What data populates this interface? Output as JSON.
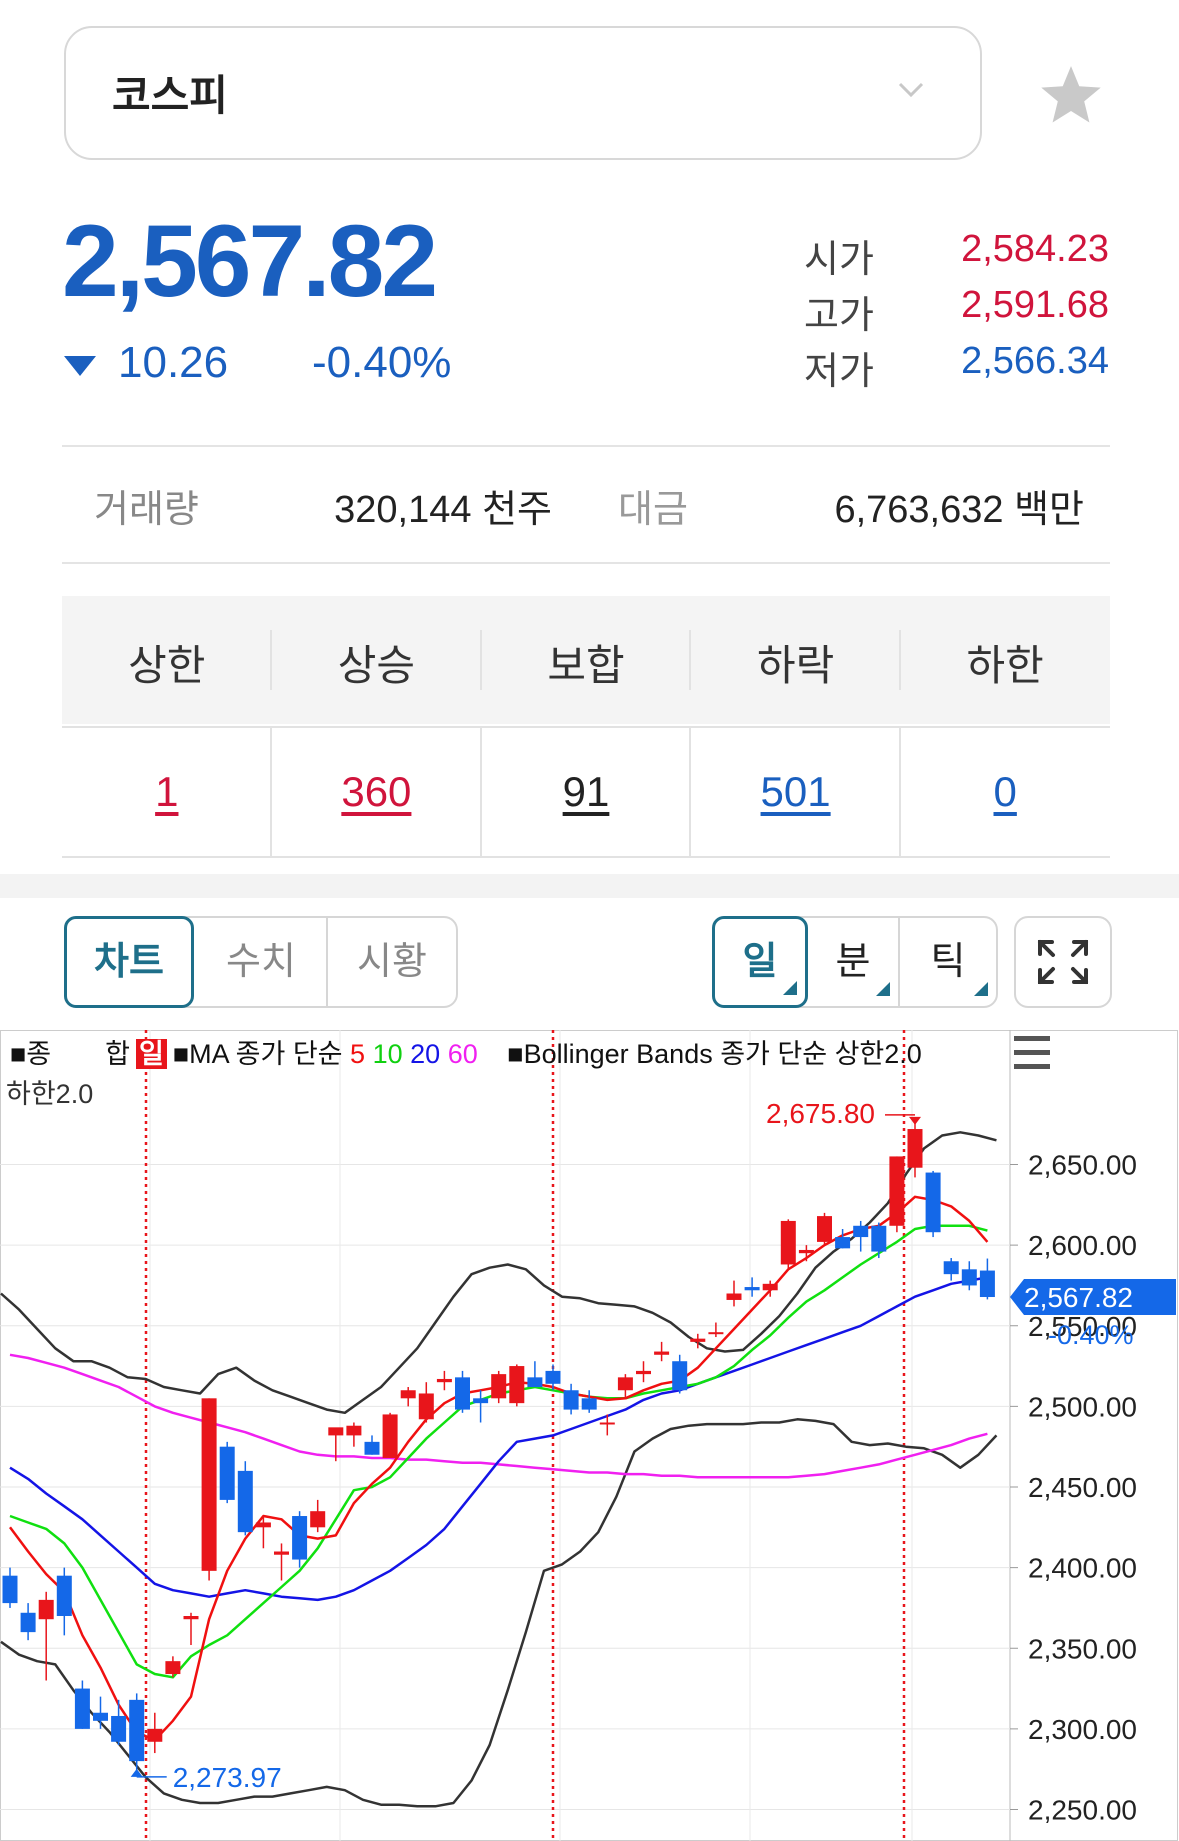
{
  "index_selector": {
    "label": "코스피"
  },
  "quote": {
    "price": "2,567.82",
    "change": "10.26",
    "change_pct": "-0.40%",
    "open_label": "시가",
    "open": "2,584.23",
    "high_label": "고가",
    "high": "2,591.68",
    "low_label": "저가",
    "low": "2,566.34"
  },
  "volume": {
    "label": "거래량",
    "value": "320,144 천주",
    "amount_label": "대금",
    "amount_value": "6,763,632 백만"
  },
  "breadth": {
    "headers": [
      "상한",
      "상승",
      "보합",
      "하락",
      "하한"
    ],
    "values": [
      "1",
      "360",
      "91",
      "501",
      "0"
    ]
  },
  "tabs": {
    "view": [
      "차트",
      "수치",
      "시황"
    ],
    "period": [
      "일",
      "분",
      "틱"
    ]
  },
  "legend": {
    "type_prefix": "■종　　합",
    "period_tag": "일",
    "ma_prefix": "■MA 종가 단순",
    "ma_periods": [
      "5",
      "10",
      "20",
      "60"
    ],
    "bb_label": "■Bollinger Bands 종가 단순 상한2.0",
    "bb_lower": "하한2.0"
  },
  "colors": {
    "up": "#e8151b",
    "down": "#1468e8",
    "ma5": "#f01010",
    "ma10": "#10e010",
    "ma20": "#1414e6",
    "ma60": "#f020f0",
    "bb": "#333333"
  },
  "chart_data": {
    "type": "candlestick",
    "y_ticks": [
      2250,
      2300,
      2350,
      2400,
      2450,
      2500,
      2550,
      2600,
      2650
    ],
    "y_tick_labels": [
      "2,250.00",
      "2,300.00",
      "2,350.00",
      "2,400.00",
      "2,450.00",
      "2,500.00",
      "2,550.00",
      "2,600.00",
      "2,650.00"
    ],
    "ylim": [
      2237,
      2738
    ],
    "current_price_label": "2,567.82",
    "current_price": 2567.82,
    "current_change_label": "-0.40%",
    "high_marker": {
      "label": "2,675.80",
      "value": 2675.8
    },
    "low_marker": {
      "label": "2,273.97",
      "value": 2273.97
    },
    "candles": [
      {
        "o": 2395,
        "h": 2400,
        "l": 2375,
        "c": 2378
      },
      {
        "o": 2372,
        "h": 2378,
        "l": 2355,
        "c": 2360
      },
      {
        "o": 2368,
        "h": 2385,
        "l": 2330,
        "c": 2380
      },
      {
        "o": 2395,
        "h": 2400,
        "l": 2358,
        "c": 2370
      },
      {
        "o": 2325,
        "h": 2330,
        "l": 2300,
        "c": 2300
      },
      {
        "o": 2310,
        "h": 2320,
        "l": 2300,
        "c": 2305
      },
      {
        "o": 2308,
        "h": 2318,
        "l": 2290,
        "c": 2292
      },
      {
        "o": 2318,
        "h": 2322,
        "l": 2273.97,
        "c": 2280
      },
      {
        "o": 2292,
        "h": 2310,
        "l": 2285,
        "c": 2300
      },
      {
        "o": 2334,
        "h": 2345,
        "l": 2332,
        "c": 2342
      },
      {
        "o": 2368,
        "h": 2372,
        "l": 2352,
        "c": 2370
      },
      {
        "o": 2398,
        "h": 2505,
        "l": 2392,
        "c": 2505
      },
      {
        "o": 2475,
        "h": 2478,
        "l": 2440,
        "c": 2442
      },
      {
        "o": 2460,
        "h": 2466,
        "l": 2420,
        "c": 2422
      },
      {
        "o": 2425,
        "h": 2432,
        "l": 2412,
        "c": 2428
      },
      {
        "o": 2408,
        "h": 2415,
        "l": 2392,
        "c": 2410
      },
      {
        "o": 2432,
        "h": 2435,
        "l": 2400,
        "c": 2405
      },
      {
        "o": 2425,
        "h": 2442,
        "l": 2422,
        "c": 2435
      },
      {
        "o": 2482,
        "h": 2486,
        "l": 2466,
        "c": 2487
      },
      {
        "o": 2482,
        "h": 2490,
        "l": 2475,
        "c": 2488
      },
      {
        "o": 2478,
        "h": 2482,
        "l": 2470,
        "c": 2470
      },
      {
        "o": 2468,
        "h": 2496,
        "l": 2468,
        "c": 2495
      },
      {
        "o": 2505,
        "h": 2512,
        "l": 2500,
        "c": 2510
      },
      {
        "o": 2492,
        "h": 2515,
        "l": 2490,
        "c": 2508
      },
      {
        "o": 2515,
        "h": 2522,
        "l": 2510,
        "c": 2517
      },
      {
        "o": 2518,
        "h": 2522,
        "l": 2496,
        "c": 2498
      },
      {
        "o": 2505,
        "h": 2510,
        "l": 2490,
        "c": 2502
      },
      {
        "o": 2505,
        "h": 2522,
        "l": 2502,
        "c": 2520
      },
      {
        "o": 2502,
        "h": 2526,
        "l": 2500,
        "c": 2525
      },
      {
        "o": 2518,
        "h": 2528,
        "l": 2512,
        "c": 2512
      },
      {
        "o": 2522,
        "h": 2526,
        "l": 2510,
        "c": 2514
      },
      {
        "o": 2510,
        "h": 2514,
        "l": 2495,
        "c": 2498
      },
      {
        "o": 2505,
        "h": 2510,
        "l": 2496,
        "c": 2498
      },
      {
        "o": 2490,
        "h": 2495,
        "l": 2482,
        "c": 2490
      },
      {
        "o": 2510,
        "h": 2520,
        "l": 2505,
        "c": 2518
      },
      {
        "o": 2520,
        "h": 2528,
        "l": 2515,
        "c": 2522
      },
      {
        "o": 2532,
        "h": 2540,
        "l": 2528,
        "c": 2534
      },
      {
        "o": 2528,
        "h": 2532,
        "l": 2508,
        "c": 2510
      },
      {
        "o": 2540,
        "h": 2545,
        "l": 2536,
        "c": 2542
      },
      {
        "o": 2545,
        "h": 2552,
        "l": 2543,
        "c": 2546
      },
      {
        "o": 2566,
        "h": 2578,
        "l": 2562,
        "c": 2570
      },
      {
        "o": 2574,
        "h": 2580,
        "l": 2568,
        "c": 2572
      },
      {
        "o": 2572,
        "h": 2578,
        "l": 2568,
        "c": 2576
      },
      {
        "o": 2588,
        "h": 2616,
        "l": 2585,
        "c": 2615
      },
      {
        "o": 2595,
        "h": 2600,
        "l": 2590,
        "c": 2597
      },
      {
        "o": 2602,
        "h": 2620,
        "l": 2600,
        "c": 2618
      },
      {
        "o": 2605,
        "h": 2610,
        "l": 2598,
        "c": 2598
      },
      {
        "o": 2612,
        "h": 2615,
        "l": 2596,
        "c": 2605
      },
      {
        "o": 2612,
        "h": 2614,
        "l": 2592,
        "c": 2596
      },
      {
        "o": 2612,
        "h": 2655,
        "l": 2608,
        "c": 2655
      },
      {
        "o": 2648,
        "h": 2675.8,
        "l": 2642,
        "c": 2672
      },
      {
        "o": 2645,
        "h": 2646,
        "l": 2605,
        "c": 2608
      },
      {
        "o": 2590,
        "h": 2592,
        "l": 2578,
        "c": 2582
      },
      {
        "o": 2585,
        "h": 2590,
        "l": 2572,
        "c": 2575
      },
      {
        "o": 2584.23,
        "h": 2591.68,
        "l": 2566.34,
        "c": 2567.82
      }
    ],
    "ma5": [
      2425,
      2410,
      2396,
      2385,
      2358,
      2338,
      2315,
      2298,
      2293,
      2305,
      2320,
      2368,
      2398,
      2418,
      2432,
      2430,
      2420,
      2418,
      2420,
      2440,
      2452,
      2462,
      2478,
      2492,
      2502,
      2508,
      2510,
      2512,
      2515,
      2514,
      2512,
      2508,
      2506,
      2504,
      2505,
      2510,
      2514,
      2516,
      2524,
      2536,
      2548,
      2560,
      2572,
      2585,
      2592,
      2600,
      2606,
      2610,
      2612,
      2620,
      2630,
      2628,
      2624,
      2615,
      2602
    ],
    "ma10": [
      2432,
      2428,
      2424,
      2415,
      2400,
      2380,
      2360,
      2340,
      2334,
      2332,
      2345,
      2352,
      2358,
      2368,
      2378,
      2388,
      2398,
      2412,
      2430,
      2448,
      2450,
      2456,
      2468,
      2480,
      2490,
      2500,
      2504,
      2508,
      2510,
      2512,
      2510,
      2508,
      2506,
      2505,
      2505,
      2508,
      2510,
      2512,
      2514,
      2518,
      2525,
      2535,
      2544,
      2555,
      2565,
      2572,
      2580,
      2588,
      2595,
      2602,
      2610,
      2612,
      2612,
      2612,
      2609
    ],
    "ma20": [
      2462,
      2455,
      2446,
      2438,
      2430,
      2420,
      2410,
      2400,
      2390,
      2386,
      2384,
      2382,
      2384,
      2386,
      2384,
      2382,
      2381,
      2380,
      2382,
      2386,
      2392,
      2398,
      2406,
      2414,
      2424,
      2438,
      2452,
      2466,
      2478,
      2480,
      2482,
      2486,
      2490,
      2494,
      2498,
      2504,
      2508,
      2510,
      2514,
      2518,
      2522,
      2526,
      2530,
      2534,
      2538,
      2542,
      2546,
      2550,
      2556,
      2562,
      2568,
      2572,
      2576,
      2578,
      2580
    ],
    "ma60": [
      2532,
      2530,
      2527,
      2524,
      2520,
      2516,
      2512,
      2506,
      2500,
      2496,
      2493,
      2490,
      2487,
      2484,
      2480,
      2476,
      2472,
      2470,
      2469,
      2469,
      2468,
      2468,
      2467,
      2467,
      2466,
      2465,
      2465,
      2464,
      2463,
      2462,
      2461,
      2460,
      2459,
      2459,
      2458,
      2458,
      2457,
      2457,
      2456,
      2456,
      2456,
      2456,
      2456,
      2456,
      2457,
      2458,
      2460,
      2462,
      2464,
      2467,
      2470,
      2473,
      2476,
      2480,
      2483
    ],
    "bb_upper": [
      2570,
      2560,
      2548,
      2536,
      2528,
      2528,
      2524,
      2518,
      2517,
      2512,
      2510,
      2508,
      2520,
      2524,
      2516,
      2510,
      2506,
      2502,
      2498,
      2496,
      2504,
      2512,
      2524,
      2536,
      2552,
      2568,
      2582,
      2586,
      2588,
      2585,
      2575,
      2568,
      2567,
      2564,
      2563,
      2562,
      2558,
      2552,
      2543,
      2536,
      2534,
      2535,
      2545,
      2556,
      2570,
      2586,
      2596,
      2604,
      2614,
      2626,
      2644,
      2660,
      2668,
      2670,
      2668,
      2665
    ],
    "bb_lower": [
      2354,
      2346,
      2342,
      2340,
      2324,
      2310,
      2298,
      2284,
      2270,
      2260,
      2256,
      2254,
      2254,
      2256,
      2258,
      2258,
      2260,
      2262,
      2264,
      2262,
      2256,
      2253,
      2253,
      2252,
      2252,
      2254,
      2268,
      2290,
      2324,
      2360,
      2398,
      2402,
      2410,
      2422,
      2444,
      2472,
      2480,
      2486,
      2488,
      2489,
      2489,
      2489,
      2490,
      2490,
      2492,
      2491,
      2489,
      2478,
      2476,
      2477,
      2475,
      2474,
      2470,
      2462,
      2470,
      2482
    ]
  }
}
